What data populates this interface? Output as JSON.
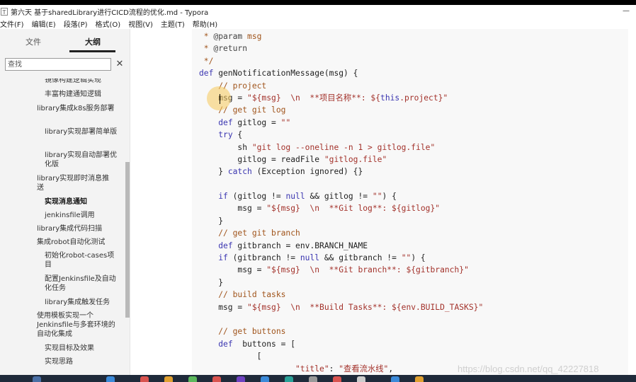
{
  "window": {
    "title": "第六天 基于sharedLibrary进行CICD流程的优化.md - Typora",
    "app_icon": "T",
    "minimize": "—"
  },
  "menu": [
    "文件(F)",
    "编辑(E)",
    "段落(P)",
    "格式(O)",
    "视图(V)",
    "主题(T)",
    "帮助(H)"
  ],
  "sidebar": {
    "tabs": {
      "files": "文件",
      "outline": "大纲"
    },
    "search_placeholder": "查找",
    "clear": "✕",
    "outline_items": [
      {
        "text": "镜像构建逻辑实现",
        "level": 3
      },
      {
        "text": "丰富构建通知逻辑",
        "level": 3
      },
      {
        "text": "library集成k8s服务部署",
        "level": 2
      },
      {
        "text": "library实现部署简单版",
        "level": 3
      },
      {
        "text": "library实现自动部署优化版",
        "level": 3
      },
      {
        "text": "library实现即时消息推送",
        "level": 2
      },
      {
        "text": "实现消息通知",
        "level": 3,
        "active": true
      },
      {
        "text": "jenkinsfile调用",
        "level": 3
      },
      {
        "text": "library集成代码扫描",
        "level": 2
      },
      {
        "text": "集成robot自动化测试",
        "level": 2
      },
      {
        "text": "初始化robot-cases项目",
        "level": 3
      },
      {
        "text": "配置Jenkinsfile及自动化任务",
        "level": 3
      },
      {
        "text": "library集成触发任务",
        "level": 3
      },
      {
        "text": "使用模板实现一个Jenkinsfile与多套环境的自动化集成",
        "level": 2
      },
      {
        "text": "实现目标及效果",
        "level": 3
      },
      {
        "text": "实现思路",
        "level": 3
      }
    ],
    "footer": {
      "back": "‹",
      "code_toggle": "</>"
    }
  },
  "editor": {
    "lines": [
      [
        [
          "cm",
          " * "
        ],
        [
          "at",
          "@param"
        ],
        [
          "cm",
          " msg"
        ]
      ],
      [
        [
          "cm",
          " * "
        ],
        [
          "at",
          "@return"
        ]
      ],
      [
        [
          "cm",
          " */"
        ]
      ],
      [
        [
          "kw",
          "def"
        ],
        [
          "pl",
          " genNotificationMessage(msg) {"
        ]
      ],
      [
        [
          "pl",
          "    "
        ],
        [
          "cm",
          "// project"
        ]
      ],
      [
        [
          "pl",
          "    msg = "
        ],
        [
          "st",
          "\"${msg}  \\n  **项目名称**: ${"
        ],
        [
          "kw",
          "this"
        ],
        [
          "st",
          ".project}\""
        ]
      ],
      [
        [
          "pl",
          "    "
        ],
        [
          "cm",
          "// get git log"
        ]
      ],
      [
        [
          "pl",
          "    "
        ],
        [
          "kw",
          "def"
        ],
        [
          "pl",
          " gitlog = "
        ],
        [
          "st",
          "\"\""
        ]
      ],
      [
        [
          "pl",
          "    "
        ],
        [
          "kw",
          "try"
        ],
        [
          "pl",
          " {"
        ]
      ],
      [
        [
          "pl",
          "        sh "
        ],
        [
          "st",
          "\"git log --oneline -n 1 > gitlog.file\""
        ]
      ],
      [
        [
          "pl",
          "        gitlog = readFile "
        ],
        [
          "st",
          "\"gitlog.file\""
        ]
      ],
      [
        [
          "pl",
          "    } "
        ],
        [
          "kw",
          "catch"
        ],
        [
          "pl",
          " (Exception ignored) {}"
        ]
      ],
      [
        [
          "pl",
          ""
        ]
      ],
      [
        [
          "pl",
          "    "
        ],
        [
          "kw",
          "if"
        ],
        [
          "pl",
          " (gitlog != "
        ],
        [
          "kw",
          "null"
        ],
        [
          "pl",
          " && gitlog != "
        ],
        [
          "st",
          "\"\""
        ],
        [
          "pl",
          ") {"
        ]
      ],
      [
        [
          "pl",
          "        msg = "
        ],
        [
          "st",
          "\"${msg}  \\n  **Git log**: ${gitlog}\""
        ]
      ],
      [
        [
          "pl",
          "    }"
        ]
      ],
      [
        [
          "pl",
          "    "
        ],
        [
          "cm",
          "// get git branch"
        ]
      ],
      [
        [
          "pl",
          "    "
        ],
        [
          "kw",
          "def"
        ],
        [
          "pl",
          " gitbranch = env.BRANCH_NAME"
        ]
      ],
      [
        [
          "pl",
          "    "
        ],
        [
          "kw",
          "if"
        ],
        [
          "pl",
          " (gitbranch != "
        ],
        [
          "kw",
          "null"
        ],
        [
          "pl",
          " && gitbranch != "
        ],
        [
          "st",
          "\"\""
        ],
        [
          "pl",
          ") {"
        ]
      ],
      [
        [
          "pl",
          "        msg = "
        ],
        [
          "st",
          "\"${msg}  \\n  **Git branch**: ${gitbranch}\""
        ]
      ],
      [
        [
          "pl",
          "    }"
        ]
      ],
      [
        [
          "pl",
          "    "
        ],
        [
          "cm",
          "// build tasks"
        ]
      ],
      [
        [
          "pl",
          "    msg = "
        ],
        [
          "st",
          "\"${msg}  \\n  **Build Tasks**: ${env.BUILD_TASKS}\""
        ]
      ],
      [
        [
          "pl",
          ""
        ]
      ],
      [
        [
          "pl",
          "    "
        ],
        [
          "cm",
          "// get buttons"
        ]
      ],
      [
        [
          "pl",
          "    "
        ],
        [
          "kw",
          "def"
        ],
        [
          "pl",
          "  buttons = ["
        ]
      ],
      [
        [
          "pl",
          "            ["
        ]
      ],
      [
        [
          "pl",
          "                    "
        ],
        [
          "st",
          "\"title\""
        ],
        [
          "pl",
          ": "
        ],
        [
          "st",
          "\"查看流水线\""
        ],
        [
          "pl",
          ","
        ]
      ]
    ]
  },
  "watermark": "https://blog.csdn.net/qq_42227818",
  "colors": {
    "sidebar_bg": "#f3f3f3",
    "editor_bg": "#f8f8f8",
    "comment": "#a0541b",
    "keyword": "#3a35b0",
    "string": "#a3322b",
    "taskbar": "#1f2a3a"
  }
}
